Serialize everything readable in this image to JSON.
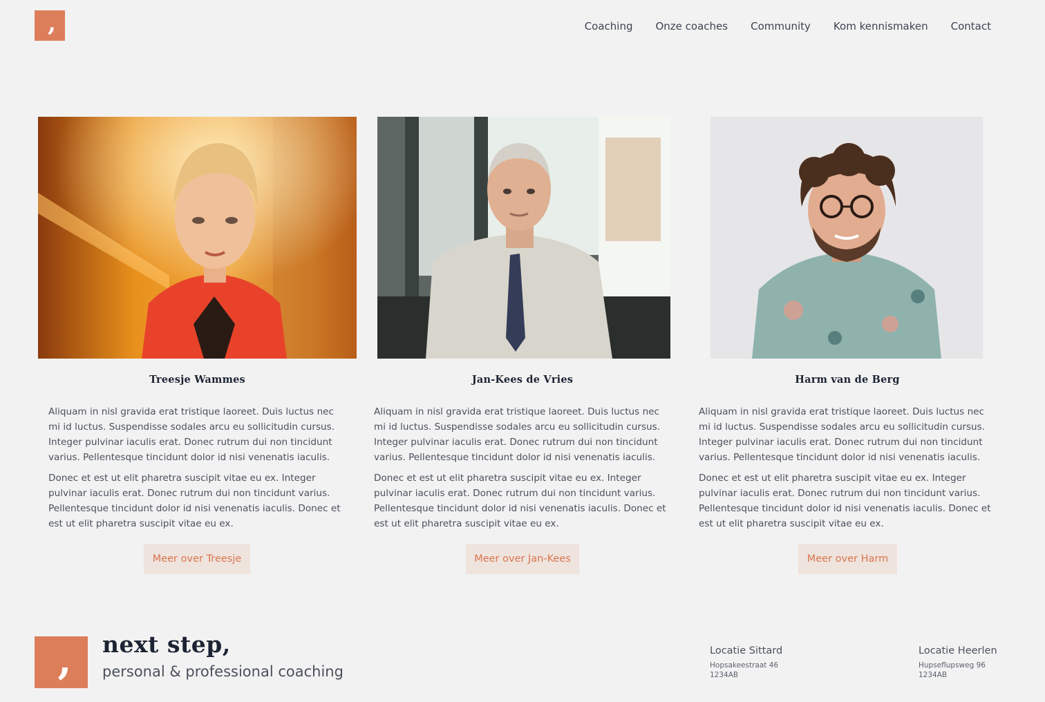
{
  "header": {
    "logo_glyph": ",",
    "nav": [
      {
        "label": "Coaching"
      },
      {
        "label": "Onze coaches"
      },
      {
        "label": "Community"
      },
      {
        "label": "Kom kennismaken"
      },
      {
        "label": "Contact"
      }
    ]
  },
  "coaches": [
    {
      "name": "Treesje Wammes",
      "photo_icon": "woman-red-blazer-photo",
      "bio": [
        "Aliquam in nisl gravida erat tristique laoreet. Duis luctus nec mi id luctus. Suspendisse sodales arcu eu sollicitudin cursus. Integer pulvinar iaculis erat. Donec rutrum dui non tincidunt varius. Pellentesque tincidunt dolor id nisi venenatis iaculis.",
        "Donec et est ut elit pharetra suscipit vitae eu ex. Integer pulvinar iaculis erat. Donec rutrum dui non tincidunt varius. Pellentesque tincidunt dolor id nisi venenatis iaculis. Donec et est ut elit pharetra suscipit vitae eu ex."
      ],
      "button": "Meer over Treesje"
    },
    {
      "name": "Jan-Kees de Vries",
      "photo_icon": "man-shirt-tie-photo",
      "bio": [
        "Aliquam in nisl gravida erat tristique laoreet. Duis luctus nec mi id luctus. Suspendisse sodales arcu eu sollicitudin cursus. Integer pulvinar iaculis erat. Donec rutrum dui non tincidunt varius. Pellentesque tincidunt dolor id nisi venenatis iaculis.",
        "Donec et est ut elit pharetra suscipit vitae eu ex. Integer pulvinar iaculis erat. Donec rutrum dui non tincidunt varius. Pellentesque tincidunt dolor id nisi venenatis iaculis. Donec et est ut elit pharetra suscipit vitae eu ex."
      ],
      "button": "Meer over Jan-Kees"
    },
    {
      "name": "Harm van de Berg",
      "photo_icon": "man-curly-hair-glasses-photo",
      "bio": [
        "Aliquam in nisl gravida erat tristique laoreet. Duis luctus nec mi id luctus. Suspendisse sodales arcu eu sollicitudin cursus. Integer pulvinar iaculis erat. Donec rutrum dui non tincidunt varius. Pellentesque tincidunt dolor id nisi venenatis iaculis.",
        "Donec et est ut elit pharetra suscipit vitae eu ex. Integer pulvinar iaculis erat. Donec rutrum dui non tincidunt varius. Pellentesque tincidunt dolor id nisi venenatis iaculis. Donec et est ut elit pharetra suscipit vitae eu ex."
      ],
      "button": "Meer over Harm"
    }
  ],
  "footer": {
    "logo_glyph": ",",
    "brand_name": "next step,",
    "tagline": "personal & professional coaching",
    "locations": [
      {
        "title": "Locatie Sittard",
        "street": "Hopsakeestraat 46",
        "postcode": "1234AB"
      },
      {
        "title": "Locatie Heerlen",
        "street": "Hupseflupsweg 96",
        "postcode": "1234AB"
      }
    ]
  },
  "colors": {
    "accent": "#dd7e5a",
    "button_bg": "#efe3dd",
    "background": "#f2f2f2",
    "heading": "#1c2433"
  }
}
